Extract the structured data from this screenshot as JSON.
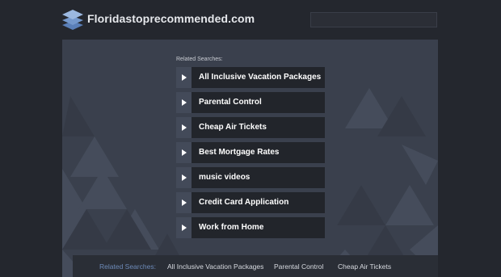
{
  "header": {
    "site_name": "Floridastoprecommended.com",
    "logo_icon": "stacked-layers-icon",
    "search": {
      "value": ""
    }
  },
  "main": {
    "related_title": "Related Searches:",
    "links": [
      {
        "label": "All Inclusive Vacation Packages",
        "icon": "play-arrow-icon"
      },
      {
        "label": "Parental Control",
        "icon": "play-arrow-icon"
      },
      {
        "label": "Cheap Air Tickets",
        "icon": "play-arrow-icon"
      },
      {
        "label": "Best Mortgage Rates",
        "icon": "play-arrow-icon"
      },
      {
        "label": "music videos",
        "icon": "play-arrow-icon"
      },
      {
        "label": "Credit Card Application",
        "icon": "play-arrow-icon"
      },
      {
        "label": "Work from Home",
        "icon": "play-arrow-icon"
      }
    ]
  },
  "footer": {
    "title": "Related Searches:",
    "links": [
      "All Inclusive Vacation Packages",
      "Parental Control",
      "Cheap Air Tickets"
    ]
  },
  "colors": {
    "background": "#24272e",
    "panel": "#3a404d",
    "link_bg": "#22252b",
    "arrow_bg": "#434a59",
    "footer_accent": "#6d8ab8"
  }
}
